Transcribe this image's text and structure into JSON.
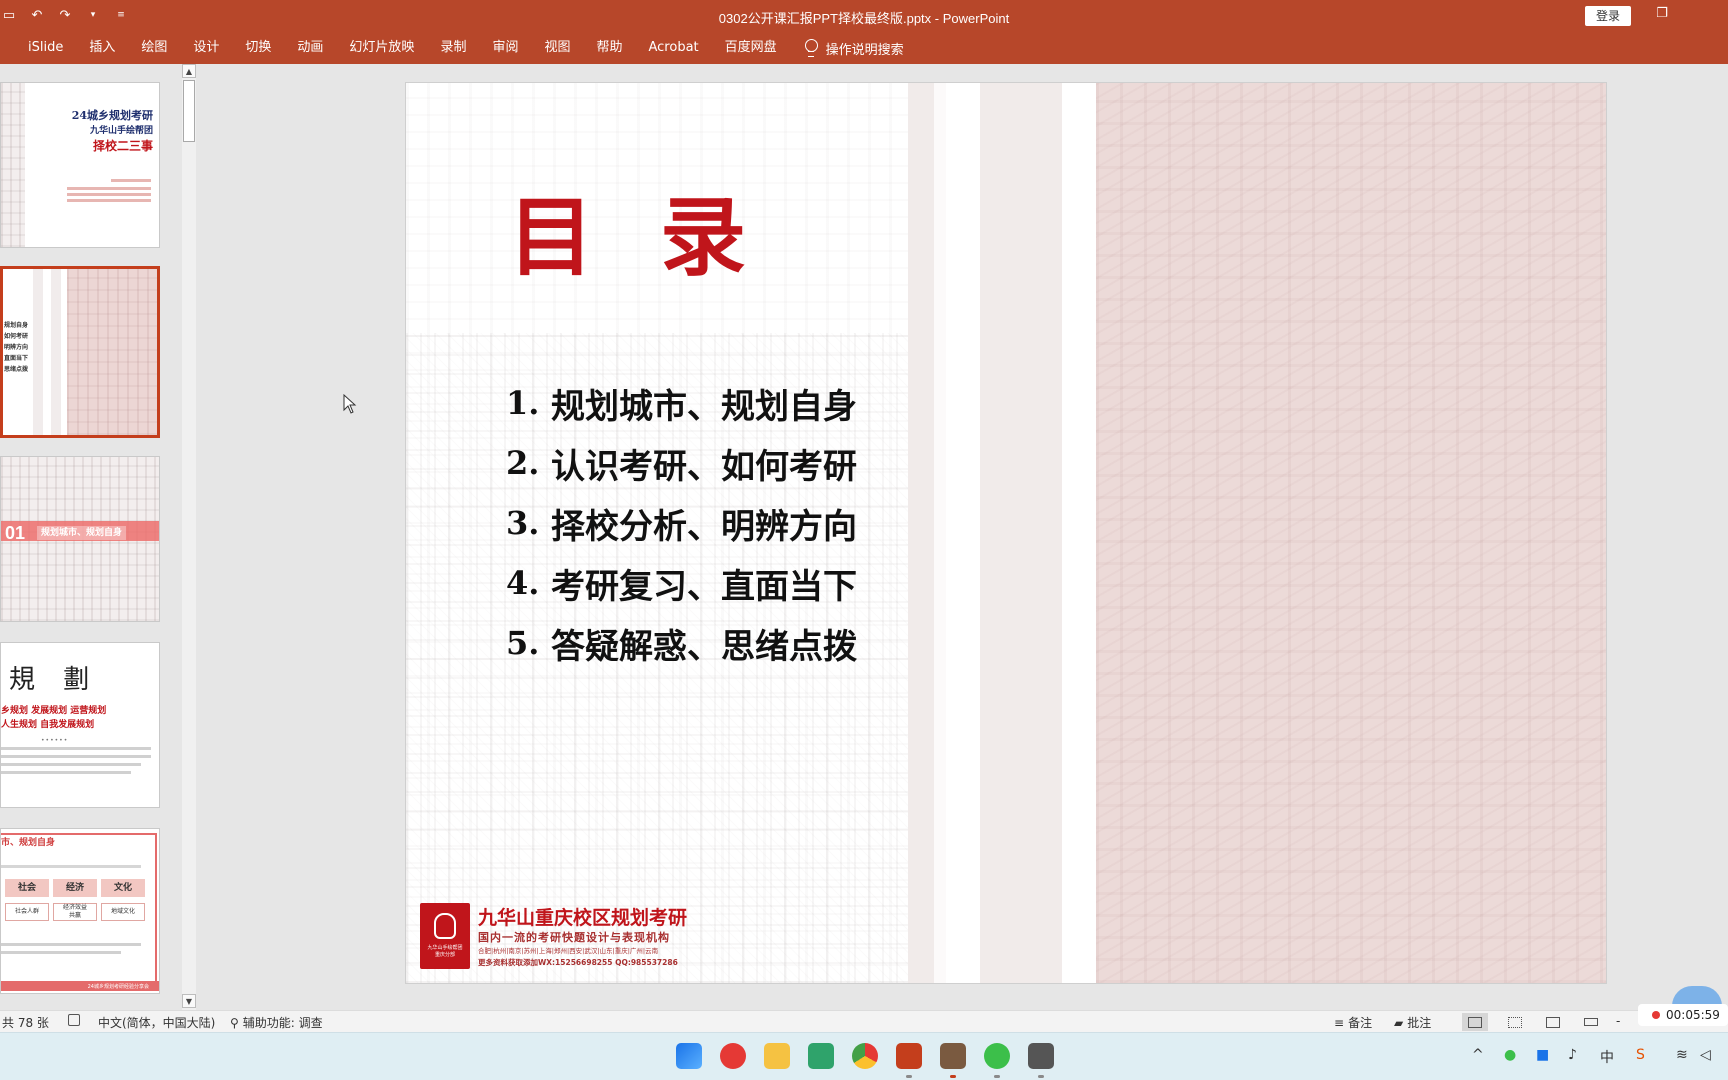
{
  "window": {
    "title": "0302公开课汇报PPT择校最终版.pptx  -  PowerPoint",
    "login_label": "登录"
  },
  "ribbon": {
    "tabs": [
      "iSlide",
      "插入",
      "绘图",
      "设计",
      "切换",
      "动画",
      "幻灯片放映",
      "录制",
      "审阅",
      "视图",
      "帮助",
      "Acrobat",
      "百度网盘"
    ],
    "search_label": "操作说明搜索"
  },
  "thumbnails": {
    "t1": {
      "line1": "24城乡规划考研",
      "line2": "九华山手绘帮团",
      "line3": "择校二三事"
    },
    "t2": {
      "lines": [
        "规划自身",
        "如何考研",
        "明辨方向",
        "直面当下",
        "思绪点拨"
      ]
    },
    "t3": {
      "num": "01",
      "label": "规划城市、规划自身"
    },
    "t4": {
      "big": "規 劃",
      "red1": "乡规划  发展规划  运营规划",
      "red2": "人生规划  自我发展规划",
      "dots": "••••••"
    },
    "t5": {
      "title": "市、规划自身",
      "boxes": [
        "社会",
        "经济",
        "文化"
      ],
      "subboxes": [
        "社会人群",
        "经济效益\n共赢",
        "地域文化"
      ],
      "footer": "24城乡规划考研经验分享会"
    }
  },
  "slide": {
    "title": "目 录",
    "toc": [
      {
        "num": "1.",
        "text": "规划城市、规划自身"
      },
      {
        "num": "2.",
        "text": "认识考研、如何考研"
      },
      {
        "num": "3.",
        "text": "择校分析、明辨方向"
      },
      {
        "num": "4.",
        "text": "考研复习、直面当下"
      },
      {
        "num": "5.",
        "text": "答疑解惑、思绪点拨"
      }
    ],
    "brand": {
      "name": "九华山重庆校区规划考研",
      "sub": "国内一流的考研快题设计与表现机构",
      "cities": "合肥|杭州|南京|苏州|上海|郑州|西安|武汉|山东|重庆|广州|云南",
      "contact": "更多资料获取添加WX:15256698255  QQ:985537286",
      "logo_caption": "九华山手绘帮团\n重庆分部"
    }
  },
  "statusbar": {
    "slide_count": "共 78 张",
    "language": "中文(简体，中国大陆)",
    "accessibility": "辅助功能: 调查",
    "notes_label": "备注",
    "comments_label": "批注",
    "zoom_minus": "-"
  },
  "recorder": {
    "time": "00:05:59"
  },
  "colors": {
    "ppt_accent": "#b7472a",
    "title_red": "#c0151b",
    "selected_border": "#c43e1c"
  },
  "icons": [
    "save-icon",
    "undo-icon",
    "redo-icon",
    "customize-qat-icon",
    "lightbulb-icon",
    "restore-window-icon",
    "notes-icon",
    "comments-icon",
    "normal-view-icon",
    "sorter-view-icon",
    "reading-view-icon",
    "slideshow-icon",
    "windows-start-icon",
    "netease-music-icon",
    "file-explorer-icon",
    "chrome-icon",
    "powerpoint-icon",
    "wechat-icon"
  ]
}
